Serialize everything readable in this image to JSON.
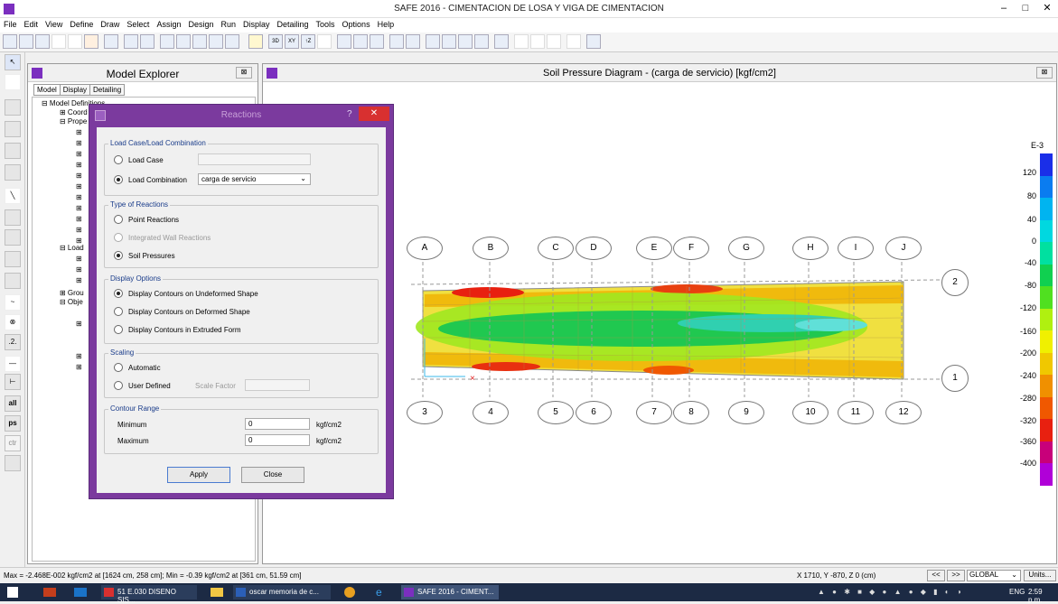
{
  "window": {
    "title": "SAFE 2016 - CIMENTACION DE LOSA Y VIGA DE CIMENTACION",
    "minimize": "–",
    "maximize": "□",
    "close": "✕"
  },
  "menu": [
    "File",
    "Edit",
    "View",
    "Define",
    "Draw",
    "Select",
    "Assign",
    "Design",
    "Run",
    "Display",
    "Detailing",
    "Tools",
    "Options",
    "Help"
  ],
  "left_tools": [
    "all",
    "ps",
    "ctr"
  ],
  "explorer": {
    "title": "Model Explorer",
    "tabs": [
      "Model",
      "Display",
      "Detailing"
    ],
    "tree": [
      "⊟ Model Definitions",
      "⊞ Coord",
      "⊟ Prope",
      "⊟ Load",
      "⊞ Grou",
      "⊟ Obje"
    ]
  },
  "diagram": {
    "title": "Soil Pressure Diagram - (carga de servicio)  [kgf/cm2]",
    "grid_top": [
      "A",
      "B",
      "C",
      "D",
      "E",
      "F",
      "G",
      "H",
      "I",
      "J"
    ],
    "grid_bottom": [
      "3",
      "4",
      "5",
      "6",
      "7",
      "8",
      "9",
      "10",
      "11",
      "12"
    ],
    "grid_right": [
      "2",
      "1"
    ],
    "legend": {
      "exponent": "E-3",
      "ticks": [
        "120",
        "80",
        "40",
        "0",
        "-40",
        "-80",
        "-120",
        "-160",
        "-200",
        "-240",
        "-280",
        "-320",
        "-360",
        "-400"
      ],
      "colors": [
        "#1a2ee8",
        "#0a7cf0",
        "#00b4f0",
        "#00d8e0",
        "#00e0a0",
        "#10d050",
        "#50e020",
        "#b0f010",
        "#f0f000",
        "#f0c800",
        "#f09000",
        "#f05800",
        "#e82010",
        "#c8007a",
        "#b000d8"
      ]
    }
  },
  "dialog": {
    "title": "Reactions",
    "help": "?",
    "close": "✕",
    "group_load": "Load Case/Load Combination",
    "load_case": "Load Case",
    "load_combination": "Load Combination",
    "combination_value": "carga de servicio",
    "group_type": "Type of Reactions",
    "point_reactions": "Point Reactions",
    "integrated_wall": "Integrated Wall Reactions",
    "soil_pressures": "Soil Pressures",
    "group_display": "Display Options",
    "undeformed": "Display Contours on Undeformed Shape",
    "deformed": "Display Contours on Deformed Shape",
    "extruded": "Display Contours in Extruded Form",
    "group_scaling": "Scaling",
    "automatic": "Automatic",
    "user_defined": "User Defined",
    "scale_factor": "Scale Factor",
    "group_contour": "Contour Range",
    "minimum_label": "Minimum",
    "minimum_value": "0",
    "maximum_label": "Maximum",
    "maximum_value": "0",
    "unit1": "kgf/cm2",
    "unit2": "kgf/cm2",
    "apply": "Apply",
    "close_btn": "Close"
  },
  "status": {
    "left": "Max = -2.468E-002 kgf/cm2 at [1624 cm, 258 cm];  Min = -0.39 kgf/cm2 at [361 cm, 51.59 cm]",
    "coords": "X 1710,  Y -870,  Z 0  (cm)",
    "prev": "<<",
    "next": ">>",
    "global": "GLOBAL",
    "units": "Units..."
  },
  "taskbar": {
    "tasks": [
      "51 E.030 DISENO SIS...",
      "oscar memoria de c...",
      "SAFE 2016 - CIMENT..."
    ],
    "lang": "ENG",
    "time": "2:59 p.m."
  }
}
